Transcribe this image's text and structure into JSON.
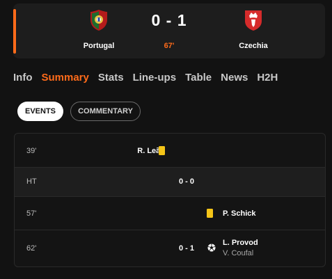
{
  "match": {
    "home": {
      "name": "Portugal",
      "crest_icon": "portugal-crest-icon"
    },
    "away": {
      "name": "Czechia",
      "crest_icon": "czechia-crest-icon"
    },
    "score": "0 - 1",
    "minute": "67'"
  },
  "tabs": [
    {
      "label": "Info",
      "active": false
    },
    {
      "label": "Summary",
      "active": true
    },
    {
      "label": "Stats",
      "active": false
    },
    {
      "label": "Line-ups",
      "active": false
    },
    {
      "label": "Table",
      "active": false
    },
    {
      "label": "News",
      "active": false
    },
    {
      "label": "H2H",
      "active": false
    }
  ],
  "filters": {
    "events": "EVENTS",
    "commentary": "COMMENTARY"
  },
  "events": [
    {
      "time": "39'",
      "type": "yellow-card",
      "side": "home",
      "player": "R. Leão"
    },
    {
      "time": "HT",
      "type": "half-time",
      "score": "0 - 0"
    },
    {
      "time": "57'",
      "type": "yellow-card",
      "side": "away",
      "player": "P. Schick"
    },
    {
      "time": "62'",
      "type": "goal",
      "side": "away",
      "score": "0 - 1",
      "player": "L. Provod",
      "assist": "V. Coufal"
    }
  ],
  "colors": {
    "accent": "#ff6b1a",
    "card": "#f5c518",
    "background": "#121212",
    "panel": "#1d1d1d"
  }
}
